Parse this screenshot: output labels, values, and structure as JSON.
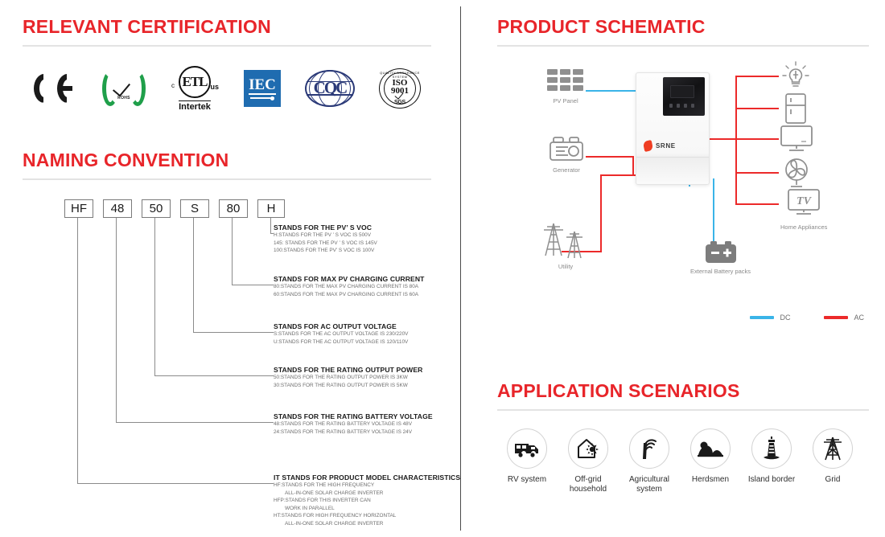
{
  "sections": {
    "certification": {
      "title": "RELEVANT CERTIFICATION"
    },
    "naming": {
      "title": "NAMING CONVENTION"
    },
    "schematic": {
      "title": "PRODUCT SCHEMATIC"
    },
    "scenarios": {
      "title": "APPLICATION SCENARIOS"
    }
  },
  "certifications": [
    {
      "name": "ce-mark",
      "label": "CE"
    },
    {
      "name": "rohs-mark",
      "label": "ROHS"
    },
    {
      "name": "etl-intertek-mark",
      "label": "ETL",
      "sub": "Intertek",
      "left": "c",
      "right": "us"
    },
    {
      "name": "iec-mark",
      "label": "IEC"
    },
    {
      "name": "cqc-mark",
      "label": "CQC"
    },
    {
      "name": "iso-mark",
      "label": "ISO",
      "number": "9001",
      "arc": "QUALITY ASSURANCE SYSTEM",
      "sub": "SGS"
    }
  ],
  "naming": {
    "code_boxes": [
      {
        "label": "HF"
      },
      {
        "label": "48"
      },
      {
        "label": "50"
      },
      {
        "label": "S"
      },
      {
        "label": "80"
      },
      {
        "label": "H"
      }
    ],
    "descriptions": [
      {
        "heading": "STANDS FOR THE PV’ S VOC",
        "lines": [
          "H:STANDS FOR THE PV ’  S VOC IS 500V",
          "145: STANDS FOR THE PV ’  S VOC IS 145V",
          "100:STANDS FOR THE PV’   S VOC IS 100V"
        ]
      },
      {
        "heading": "STANDS FOR MAX PV CHARGING CURRENT",
        "lines": [
          "80:STANDS FOR THE MAX PV CHARGING CURRENT IS 80A",
          "60:STANDS FOR THE MAX PV CHARGING CURRENT IS 60A"
        ]
      },
      {
        "heading": "STANDS FOR AC OUTPUT VOLTAGE",
        "lines": [
          "S:STANDS FOR THE  AC OUTPUT VOLTAGE IS 230/220V",
          "U:STANDS FOR THE  AC OUTPUT VOLTAGE IS 120/110V"
        ]
      },
      {
        "heading": "STANDS FOR THE RATING OUTPUT POWER",
        "lines": [
          "50:STANDS FOR THE RATING OUTPUT POWER IS 3KW",
          "30:STANDS FOR THE RATING OUTPUT POWER IS 5KW"
        ]
      },
      {
        "heading": "STANDS FOR THE  RATING BATTERY VOLTAGE",
        "lines": [
          "48:STANDS FOR THE RATING BATTERY VOLTAGE IS 48V",
          "24:STANDS FOR THE RATING BATTERY VOLTAGE IS 24V"
        ]
      },
      {
        "heading": "IT STANDS  FOR PRODUCT MODEL CHARACTERISTICS",
        "lines": [
          "HF:STANDS FOR THE HIGH FREQUENCY",
          "ALL-IN-ONE SOLAR CHARGE INVERTER",
          "HFP:STANDS FOR THIS INVERTER CAN",
          "WORK IN PARALLEL",
          "HT:STANDS FOR HIGH FREQUENCY HORIZONTAL",
          "ALL-IN-ONE SOLAR CHARGE INVERTER"
        ],
        "indent_lines": [
          1,
          3,
          5
        ]
      }
    ]
  },
  "schematic": {
    "sources": [
      {
        "icon": "pv-panel-icon",
        "label": "PV Panel"
      },
      {
        "icon": "generator-icon",
        "label": "Generator"
      },
      {
        "icon": "utility-tower-icon",
        "label": "Utility"
      }
    ],
    "battery": {
      "icon": "battery-pack-icon",
      "label": "External Battery packs"
    },
    "appliances": {
      "label": "Home Appliances",
      "items": [
        {
          "icon": "light-bulb-icon"
        },
        {
          "icon": "refrigerator-icon"
        },
        {
          "icon": "monitor-icon"
        },
        {
          "icon": "fan-icon"
        },
        {
          "icon": "tv-icon"
        }
      ]
    },
    "inverter": {
      "brand": "SRNE"
    },
    "legend": [
      {
        "label": "DC",
        "color": "#3ab4e8"
      },
      {
        "label": "AC",
        "color": "#ec2a2a"
      }
    ]
  },
  "scenarios": [
    {
      "icon": "rv-icon",
      "label": "RV system"
    },
    {
      "icon": "off-grid-house-icon",
      "label": "Off-grid household"
    },
    {
      "icon": "agricultural-antenna-icon",
      "label": "Agricultural system"
    },
    {
      "icon": "herdsmen-icon",
      "label": "Herdsmen"
    },
    {
      "icon": "lighthouse-icon",
      "label": "Island border"
    },
    {
      "icon": "grid-tower-icon",
      "label": "Grid"
    }
  ],
  "colors": {
    "heading_red": "#e8252a",
    "dc_blue": "#3ab4e8",
    "ac_red": "#ec2a2a",
    "iec_blue": "#1f6cb0",
    "rohs_green": "#1f9f4a",
    "cqc_navy": "#2b3a78"
  }
}
